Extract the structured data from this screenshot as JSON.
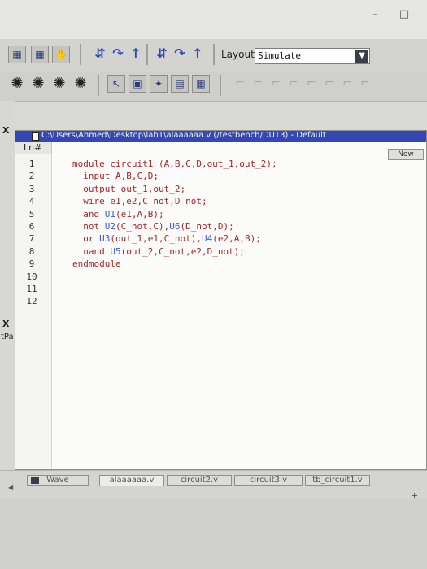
{
  "window": {
    "minimize_icon": "minimize-icon",
    "restore_icon": "restore-icon"
  },
  "toolbar": {
    "layout_label": "Layout",
    "layout_value": "Simulate"
  },
  "left_panel": {
    "close_glyph": "X",
    "partial_label": "tPa"
  },
  "editor": {
    "title": "C:\\Users\\Ahmed\\Desktop\\lab1\\alaaaaaa.v (/testbench/DUT3) - Default",
    "ln_header": "Ln#",
    "now_button": "Now",
    "lines": [
      {
        "num": "1",
        "pre": "module circuit1 (A,B,C,D,out_1,out_2);",
        "inst": "",
        "post": ""
      },
      {
        "num": "2",
        "pre": "  input A,B,C,D;",
        "inst": "",
        "post": ""
      },
      {
        "num": "3",
        "pre": "  output out_1,out_2;",
        "inst": "",
        "post": ""
      },
      {
        "num": "4",
        "pre": "  wire e1,e2,C_not,D_not;",
        "inst": "",
        "post": ""
      },
      {
        "num": "5",
        "pre": "  and ",
        "inst": "U1",
        "post": "(e1,A,B);"
      },
      {
        "num": "6",
        "pre": "  not ",
        "inst": "U2",
        "post": "(C_not,C),",
        "inst2": "U6",
        "post2": "(D_not,D);"
      },
      {
        "num": "7",
        "pre": "  or ",
        "inst": "U3",
        "post": "(out_1,e1,C_not),",
        "inst2": "U4",
        "post2": "(e2,A,B);"
      },
      {
        "num": "8",
        "pre": "  nand ",
        "inst": "U5",
        "post": "(out_2,C_not,e2,D_not);"
      },
      {
        "num": "9",
        "pre": "endmodule",
        "inst": "",
        "post": ""
      },
      {
        "num": "10",
        "pre": "",
        "inst": "",
        "post": ""
      },
      {
        "num": "11",
        "pre": "",
        "inst": "",
        "post": ""
      },
      {
        "num": "12",
        "pre": "",
        "inst": "",
        "post": ""
      }
    ]
  },
  "tabs": [
    {
      "label": "Wave"
    },
    {
      "label": "alaaaaaa.v"
    },
    {
      "label": "circuit2.v"
    },
    {
      "label": "circuit3.v"
    },
    {
      "label": "tb_circuit1.v"
    }
  ],
  "colors": {
    "title_bar": "#3348b3",
    "code_text": "#a0282a",
    "instance_text": "#3b5bd6"
  }
}
